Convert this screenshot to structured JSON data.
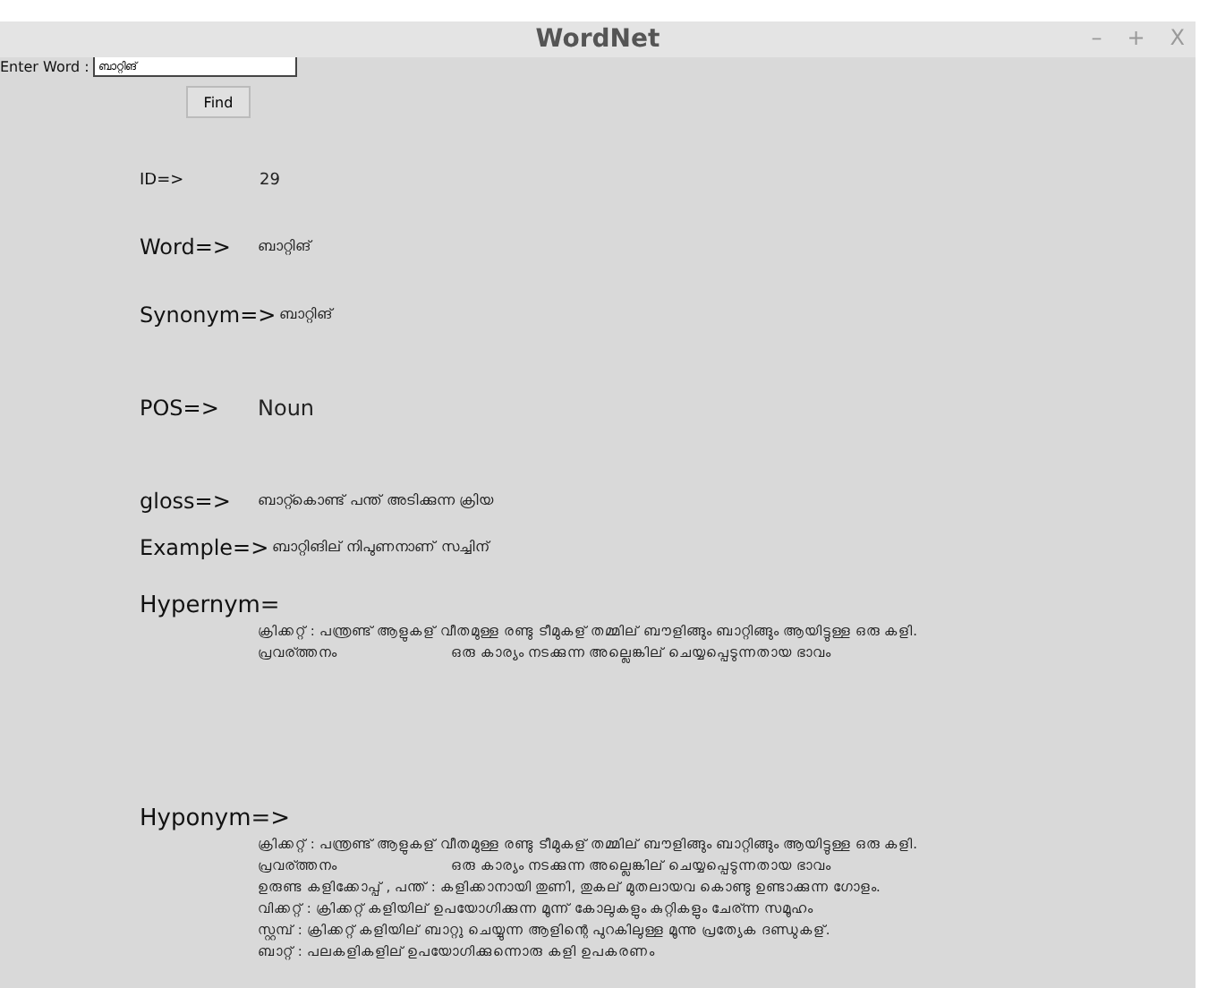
{
  "window": {
    "title": "WordNet",
    "controls": [
      "–",
      "+",
      "X"
    ]
  },
  "search": {
    "label": "Enter Word :",
    "value": "ബാറ്റിങ്",
    "button": "Find"
  },
  "fields": [
    {
      "label": "ID=>",
      "value": "29",
      "kind": "small"
    },
    {
      "label": "Word=>",
      "value": "ബാറ്റിങ്",
      "kind": "large"
    },
    {
      "label": "Synonym=>",
      "value": "ബാറ്റിങ്",
      "kind": "large"
    },
    {
      "label": "POS=>",
      "value": "Noun",
      "kind": "large"
    },
    {
      "label": "gloss=>",
      "value": "ബാറ്റ്കൊണ്ട് പന്ത് അടിക്കുന്ന ക്രിയ",
      "kind": "large"
    },
    {
      "label": "Example=>",
      "value": "ബാറ്റിങില് നിപുണനാണ് സച്ചിന്",
      "kind": "large"
    }
  ],
  "relations": [
    {
      "label": "Hypernym=",
      "lines": [
        [
          "ക്രിക്കറ്റ് : പന്ത്രണ്ട് ആളുകള് വീതമുള്ള രണ്ടു ടീമുകള് തമ്മില് ബൗളിങ്ങും ബാറ്റിങ്ങും ആയിട്ടുള്ള ഒരു കളി."
        ],
        [
          "പ്രവര്ത്തനം",
          "ഒരു കാര്യം നടക്കുന്ന അല്ലെങ്കില് ചെയ്യപ്പെടുന്നതായ ഭാവം"
        ]
      ]
    },
    {
      "label": "Hyponym=>",
      "lines": [
        [
          "ക്രിക്കറ്റ് : പന്ത്രണ്ട് ആളുകള് വീതമുള്ള രണ്ടു ടീമുകള് തമ്മില് ബൗളിങ്ങും ബാറ്റിങ്ങും ആയിട്ടുള്ള ഒരു കളി."
        ],
        [
          "പ്രവര്ത്തനം",
          "ഒരു കാര്യം നടക്കുന്ന അല്ലെങ്കില് ചെയ്യപ്പെടുന്നതായ ഭാവം"
        ],
        [
          "ഉരുണ്ട കളിക്കോപ്പ് , പന്ത് : കളിക്കാനായി തുണി, തുകല് മുതലായവ കൊണ്ടു ഉണ്ടാക്കുന്ന ഗോളം."
        ],
        [
          "വിക്കറ്റ് : ക്രിക്കറ്റ് കളിയില് ഉപയോഗിക്കുന്ന മൂന്ന് കോലുകളും കുറ്റികളും ചേര്ന്ന സമൂഹം"
        ],
        [
          "സ്റ്റമ്പ് : ക്രിക്കറ്റ് കളിയില് ബാറ്റു ചെയ്യുന്ന ആളിന്റെ പുറകിലുള്ള മൂന്നു പ്രത്യേക ദണ്ഡുകള്."
        ],
        [
          "ബാറ്റ് : പലകളികളില് ഉപയോഗിക്കുന്നൊരു കളി ഉപകരണം"
        ]
      ]
    }
  ]
}
